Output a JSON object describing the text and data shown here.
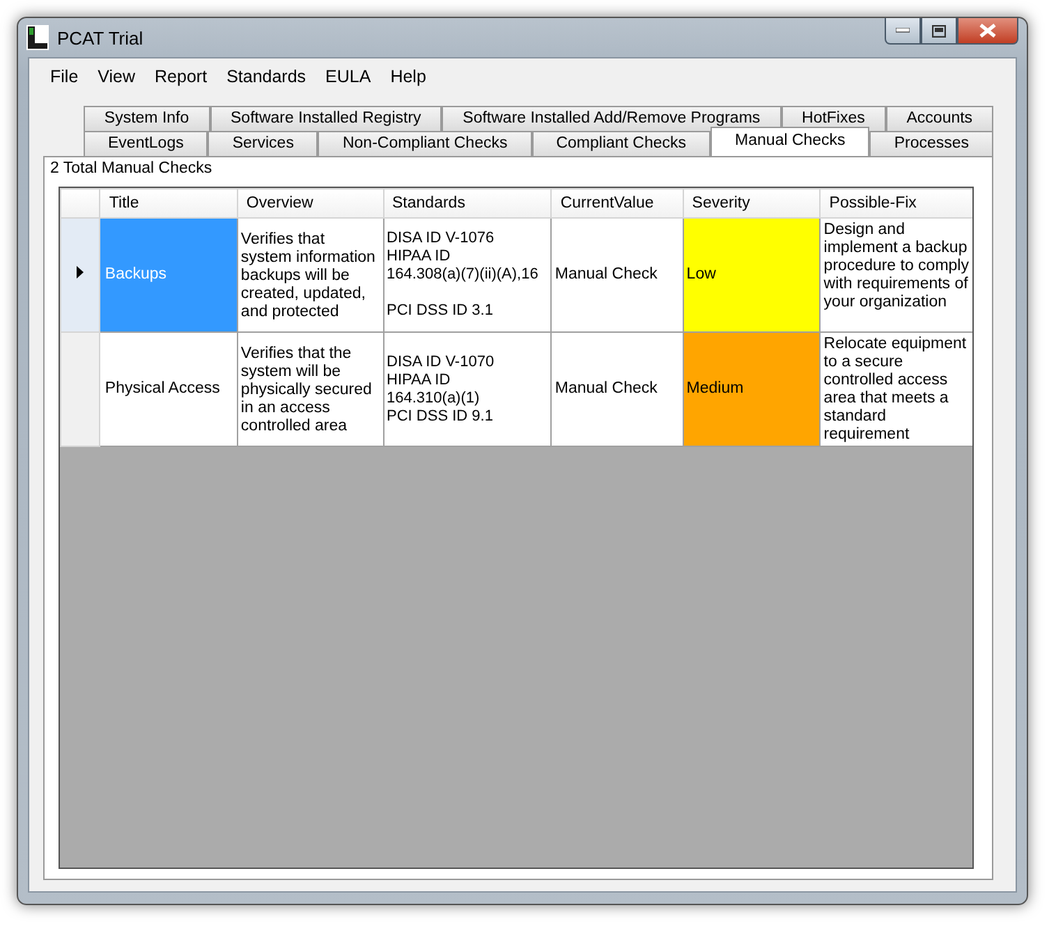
{
  "window": {
    "title": "PCAT Trial"
  },
  "menu": [
    "File",
    "View",
    "Report",
    "Standards",
    "EULA",
    "Help"
  ],
  "tab_rows": [
    [
      {
        "label": "System Info",
        "selected": false
      },
      {
        "label": "Software Installed Registry",
        "selected": false
      },
      {
        "label": "Software Installed Add/Remove Programs",
        "selected": false
      },
      {
        "label": "HotFixes",
        "selected": false
      },
      {
        "label": "Accounts",
        "selected": false
      }
    ],
    [
      {
        "label": "EventLogs",
        "selected": false
      },
      {
        "label": "Services",
        "selected": false
      },
      {
        "label": "Non-Compliant Checks",
        "selected": false
      },
      {
        "label": "Compliant Checks",
        "selected": false
      },
      {
        "label": "Manual Checks",
        "selected": true
      },
      {
        "label": "Processes",
        "selected": false
      }
    ]
  ],
  "summary": "2 Total Manual Checks",
  "table": {
    "columns": [
      "Title",
      "Overview",
      "Standards",
      "CurrentValue",
      "Severity",
      "Possible-Fix"
    ],
    "rows": [
      {
        "selected": true,
        "title": "Backups",
        "overview": "Verifies that system information backups will be created, updated, and protected",
        "standards": "DISA ID V-1076\nHIPAA ID\n164.308(a)(7)(ii)(A),16\n\nPCI DSS ID 3.1",
        "current_value": "Manual Check",
        "severity": "Low",
        "color": "#ffff00",
        "possible_fix": "Design and implement a backup procedure to comply with requirements of your organization"
      },
      {
        "selected": false,
        "title": "Physical Access",
        "overview": "Verifies that the system will be physically secured in an access controlled area",
        "standards": "DISA ID V-1070\nHIPAA ID\n164.310(a)(1)\nPCI DSS ID 9.1",
        "current_value": "Manual Check",
        "severity": "Medium",
        "color": "#ffa500",
        "possible_fix": "Relocate equipment to a secure controlled access area that meets a standard requirement"
      }
    ]
  }
}
